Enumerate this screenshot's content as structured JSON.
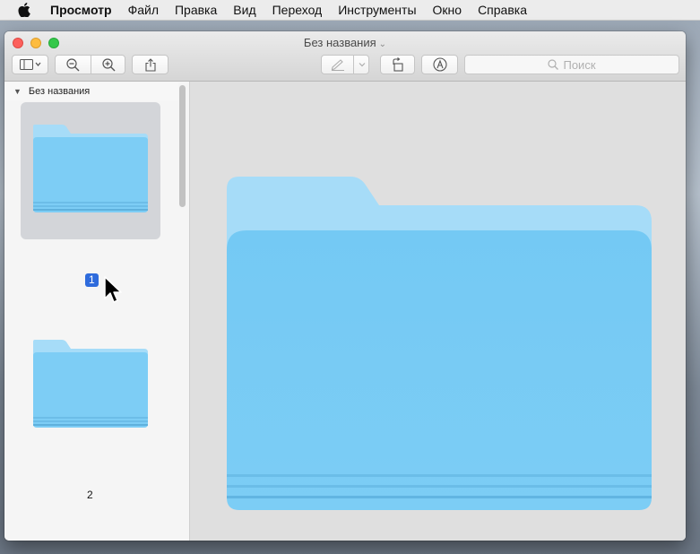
{
  "menubar": {
    "app_name": "Просмотр",
    "items": [
      "Файл",
      "Правка",
      "Вид",
      "Переход",
      "Инструменты",
      "Окно",
      "Справка"
    ]
  },
  "window": {
    "title": "Без названия",
    "title_caret": "⌄"
  },
  "toolbar": {
    "search_placeholder": "Поиск",
    "buttons": [
      "sidebar-view",
      "zoom-out",
      "zoom-in",
      "share",
      "markup-pen",
      "rotate",
      "markup-toolbar"
    ]
  },
  "sidebar": {
    "header": "Без названия",
    "pages": [
      {
        "number": "1",
        "selected": true
      },
      {
        "number": "2",
        "selected": false
      }
    ]
  },
  "colors": {
    "folder_front": "#7dcdf5",
    "folder_back": "#a6dcf8",
    "selection": "#2e6bdc"
  }
}
